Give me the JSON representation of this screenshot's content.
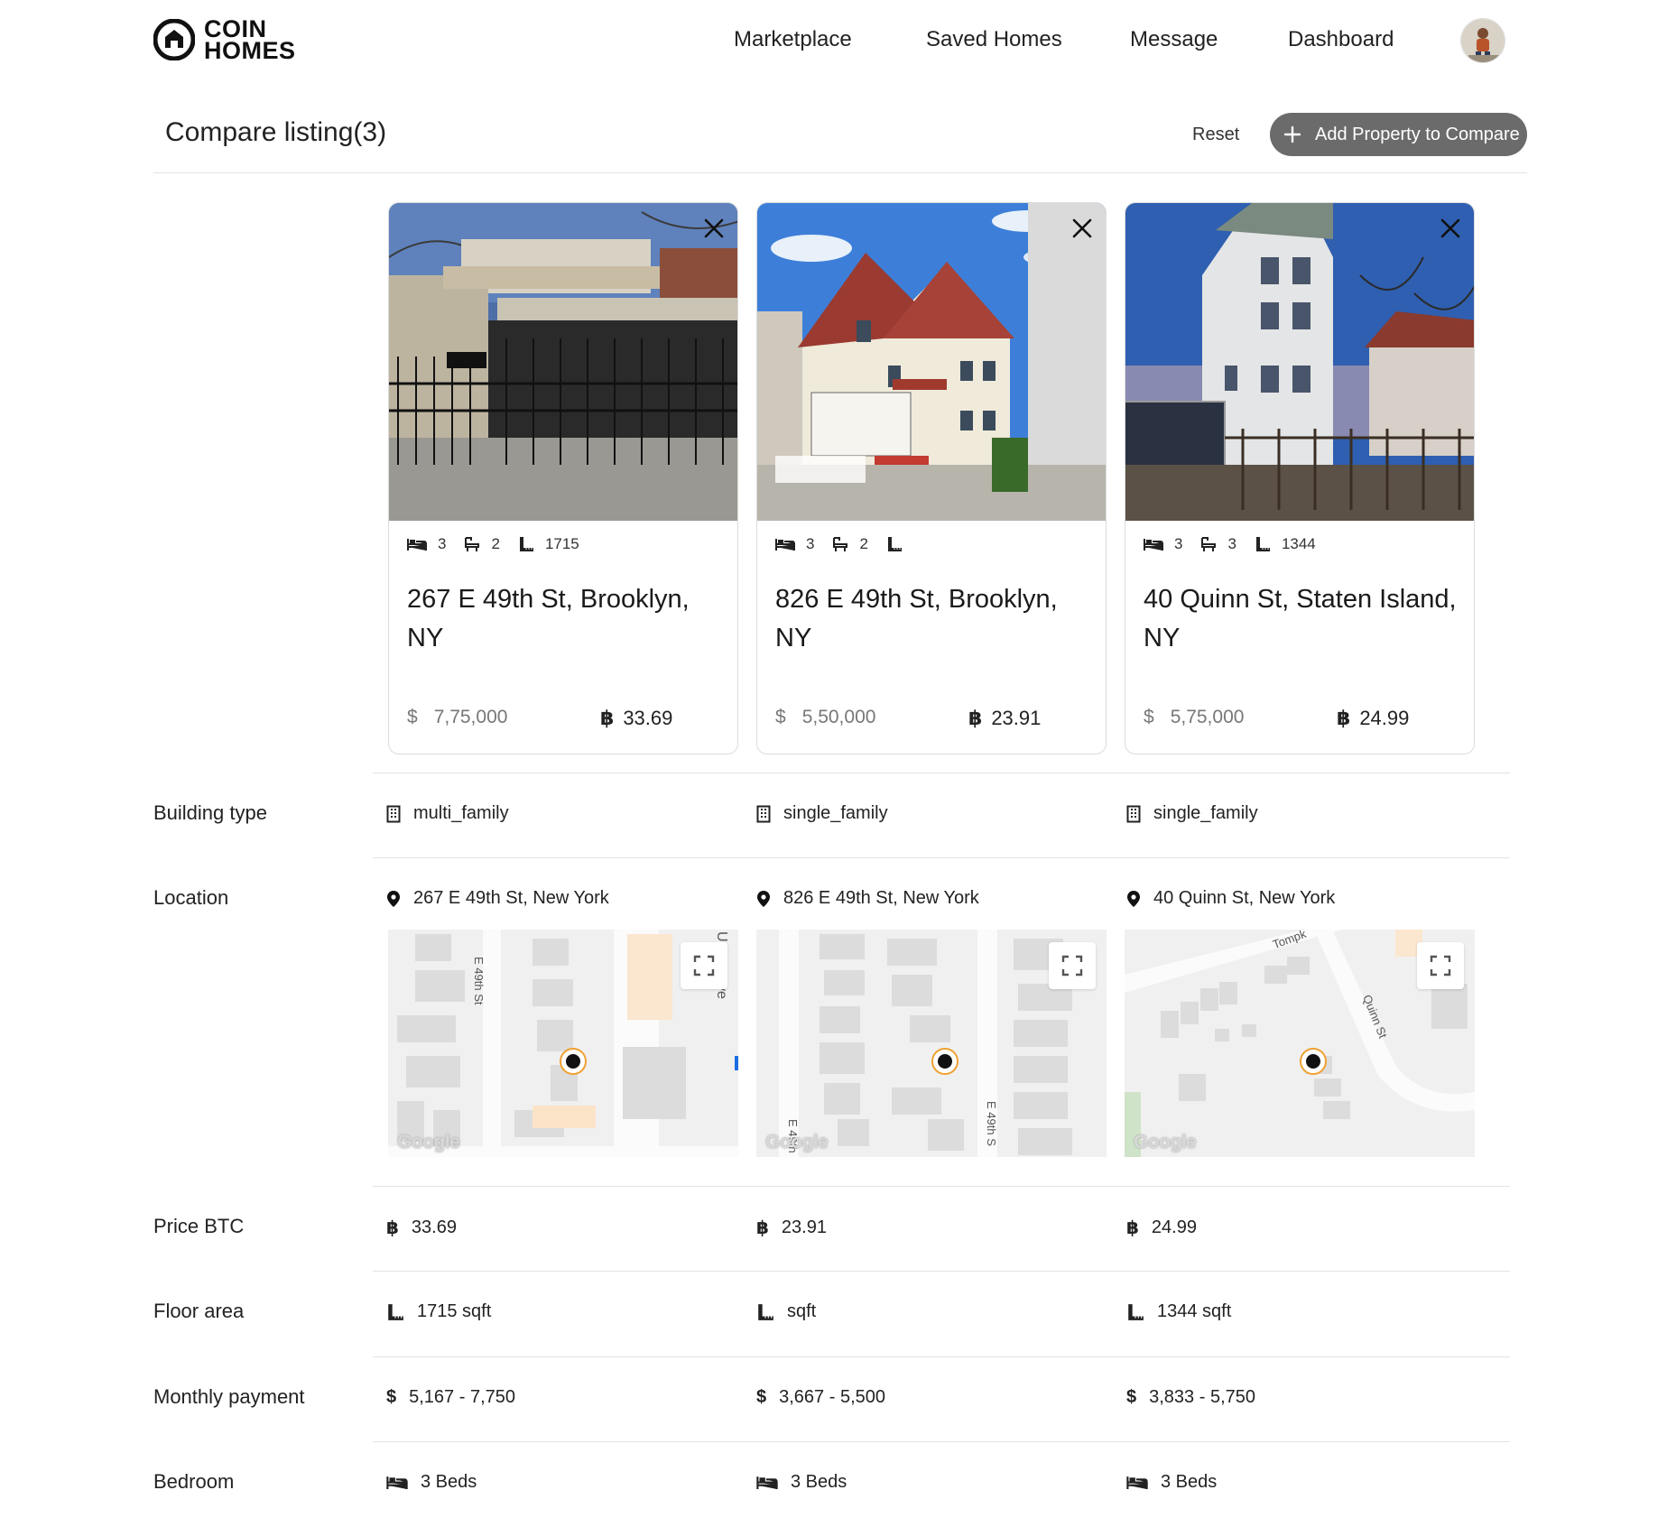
{
  "brand": {
    "line1": "COIN",
    "line2": "HOMES"
  },
  "nav": [
    {
      "label": "Marketplace"
    },
    {
      "label": "Saved Homes"
    },
    {
      "label": "Message"
    },
    {
      "label": "Dashboard"
    }
  ],
  "page": {
    "title": "Compare listing(3)",
    "reset_label": "Reset",
    "add_label": "Add Property to Compare"
  },
  "listings": [
    {
      "beds": "3",
      "baths": "2",
      "area": "1715",
      "address": "267 E 49th St, Brooklyn, NY",
      "price_usd": "7,75,000",
      "price_btc": "33.69",
      "building_type": "multi_family",
      "location": "267 E 49th St, New York",
      "map_labels": [
        "E 49th St",
        "U",
        "ve"
      ],
      "btc_row": "33.69",
      "floor_area": "1715 sqft",
      "monthly": "5,167 - 7,750",
      "bedroom": "3 Beds"
    },
    {
      "beds": "3",
      "baths": "2",
      "area": "",
      "address": "826 E 49th St, Brooklyn, NY",
      "price_usd": "5,50,000",
      "price_btc": "23.91",
      "building_type": "single_family",
      "location": "826 E 49th St, New York",
      "map_labels": [
        "E 49th S",
        "E 49th"
      ],
      "btc_row": "23.91",
      "floor_area": "sqft",
      "monthly": "3,667 - 5,500",
      "bedroom": "3 Beds"
    },
    {
      "beds": "3",
      "baths": "3",
      "area": "1344",
      "address": "40 Quinn St, Staten Island, NY",
      "price_usd": "5,75,000",
      "price_btc": "24.99",
      "building_type": "single_family",
      "location": "40 Quinn St, New York",
      "map_labels": [
        "Quinn St",
        "Tompk"
      ],
      "btc_row": "24.99",
      "floor_area": "1344 sqft",
      "monthly": "3,833 - 5,750",
      "bedroom": "3 Beds"
    }
  ],
  "rows": {
    "building_type": "Building type",
    "location": "Location",
    "price_btc": "Price BTC",
    "floor_area": "Floor area",
    "monthly": "Monthly payment",
    "bedroom": "Bedroom"
  },
  "currency": {
    "usd": "$",
    "btc": "฿"
  },
  "map_brand": "Google",
  "icons": [
    "bed-icon",
    "bath-icon",
    "ruler-icon",
    "building-icon",
    "pin-icon",
    "close-icon",
    "plus-icon",
    "expand-icon"
  ],
  "colors": {
    "button_bg": "#6b6b6b",
    "marker_ring": "#f0a030",
    "divider": "#e3e3e3"
  }
}
